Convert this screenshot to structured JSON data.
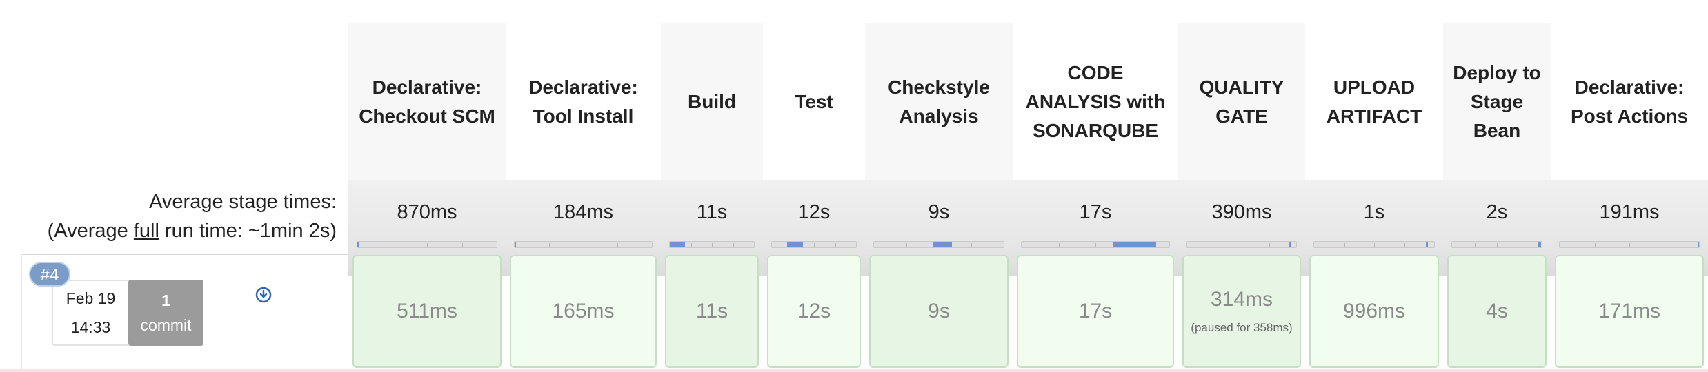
{
  "summary": {
    "line1": "Average stage times:",
    "line2_prefix": "(Average ",
    "line2_underlined": "full",
    "line2_suffix": " run time: ~1min 2s)"
  },
  "build": {
    "number": "#4",
    "date": "Feb 19",
    "time": "14:33",
    "commit_count": "1",
    "commit_label": "commit"
  },
  "stages": [
    {
      "name": "Declarative: Checkout SCM",
      "avg": "870ms",
      "run": "511ms",
      "paused": "",
      "avg_fraction_start": 0.0,
      "avg_fraction": 0.0
    },
    {
      "name": "Declarative: Tool Install",
      "avg": "184ms",
      "run": "165ms",
      "paused": "",
      "avg_fraction_start": 0.0,
      "avg_fraction": 0.0
    },
    {
      "name": "Build",
      "avg": "11s",
      "run": "11s",
      "paused": "",
      "avg_fraction_start": 0.0,
      "avg_fraction": 0.18
    },
    {
      "name": "Test",
      "avg": "12s",
      "run": "12s",
      "paused": "",
      "avg_fraction_start": 0.18,
      "avg_fraction": 0.19
    },
    {
      "name": "Checkstyle Analysis",
      "avg": "9s",
      "run": "9s",
      "paused": "",
      "avg_fraction_start": 0.45,
      "avg_fraction": 0.15
    },
    {
      "name": "CODE ANALYSIS with SONARQUBE",
      "avg": "17s",
      "run": "17s",
      "paused": "",
      "avg_fraction_start": 0.62,
      "avg_fraction": 0.29
    },
    {
      "name": "QUALITY GATE",
      "avg": "390ms",
      "run": "314ms",
      "paused": "(paused for 358ms)",
      "avg_fraction_start": 0.93,
      "avg_fraction": 0.02
    },
    {
      "name": "UPLOAD ARTIFACT",
      "avg": "1s",
      "run": "996ms",
      "paused": "",
      "avg_fraction_start": 0.93,
      "avg_fraction": 0.02
    },
    {
      "name": "Deploy to Stage Bean",
      "avg": "2s",
      "run": "4s",
      "paused": "",
      "avg_fraction_start": 0.95,
      "avg_fraction": 0.04
    },
    {
      "name": "Declarative: Post Actions",
      "avg": "191ms",
      "run": "171ms",
      "paused": "",
      "avg_fraction_start": 0.99,
      "avg_fraction": 0.0
    }
  ],
  "colors": {
    "success_cell": "#e7f5e4",
    "success_cell_alt": "#f0fdef",
    "bar_fill": "#6f93cf",
    "build_badge": "#7a9cc7",
    "commit_box": "#9b9b9b"
  },
  "icons": {
    "changes": "download-circle-icon"
  }
}
